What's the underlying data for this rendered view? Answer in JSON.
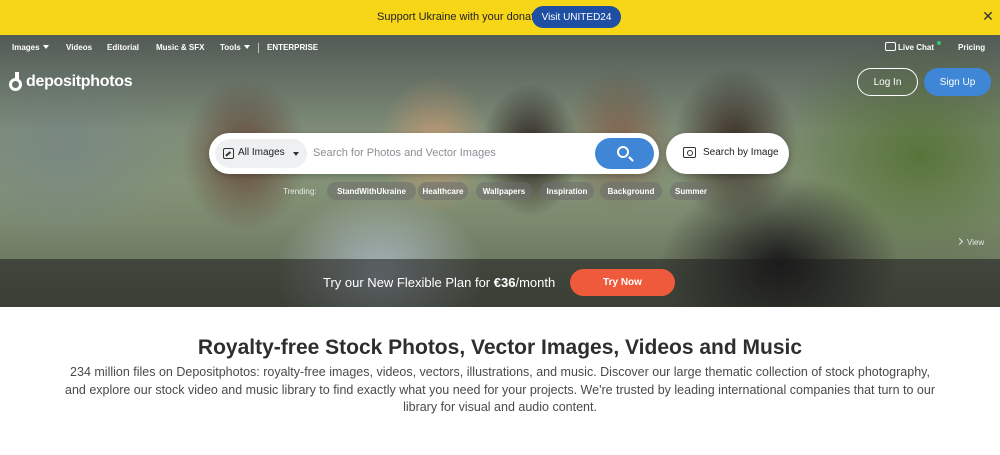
{
  "ukraine_banner": {
    "text": "Support Ukraine with your donation",
    "button": "Visit UNITED24",
    "close_glyph": "✕",
    "background_color": "#f7d618",
    "button_color": "#1f4fa3"
  },
  "nav": {
    "items": [
      "Images",
      "Videos",
      "Editorial",
      "Music & SFX",
      "Tools",
      "ENTERPRISE"
    ],
    "live_chat": "Live Chat",
    "pricing": "Pricing"
  },
  "logo": {
    "text": "depositphotos"
  },
  "auth": {
    "login": "Log In",
    "signup": "Sign Up",
    "accent_color": "#3f86d6"
  },
  "search": {
    "type_selected": "All Images",
    "placeholder": "Search for Photos and Vector Images",
    "search_by_image": "Search by Image"
  },
  "trending": {
    "label": "Trending:",
    "tags": [
      "StandWithUkraine",
      "Healthcare",
      "Wallpapers",
      "Inspiration",
      "Background",
      "Summer"
    ]
  },
  "hero": {
    "view_link": "View"
  },
  "promo": {
    "text_before": "Try our New Flexible Plan for ",
    "price": "€36",
    "text_after": "/month",
    "button": "Try Now",
    "button_color": "#f05a3c"
  },
  "content": {
    "headline": "Royalty-free Stock Photos, Vector Images, Videos and Music",
    "description": "234 million files on Depositphotos: royalty-free images, videos, vectors, illustrations, and music. Discover our large thematic collection of stock photography, and explore our stock video and music library to find exactly what you need for your projects. We're trusted by leading international companies that turn to our library for visual and audio content."
  }
}
